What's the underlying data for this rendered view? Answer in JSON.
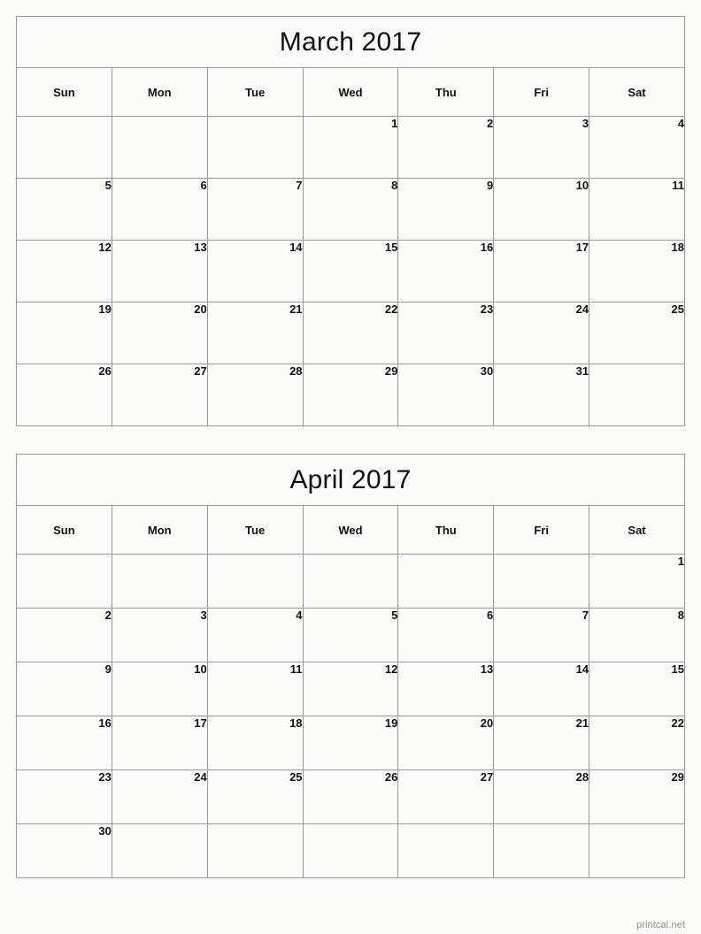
{
  "page": {
    "watermark": "printcal.net",
    "background_color": "#fbfdf8",
    "border_color": "#9a9a9a",
    "text_color": "#101010",
    "watermark_color": "#8d8d8d"
  },
  "calendars": [
    {
      "id": "march-2017",
      "title": "March 2017",
      "month": "March",
      "year": "2017",
      "weekdays": [
        "Sun",
        "Mon",
        "Tue",
        "Wed",
        "Thu",
        "Fri",
        "Sat"
      ],
      "weeks": [
        [
          "",
          "",
          "",
          "1",
          "2",
          "3",
          "4"
        ],
        [
          "5",
          "6",
          "7",
          "8",
          "9",
          "10",
          "11"
        ],
        [
          "12",
          "13",
          "14",
          "15",
          "16",
          "17",
          "18"
        ],
        [
          "19",
          "20",
          "21",
          "22",
          "23",
          "24",
          "25"
        ],
        [
          "26",
          "27",
          "28",
          "29",
          "30",
          "31",
          ""
        ]
      ]
    },
    {
      "id": "april-2017",
      "title": "April 2017",
      "month": "April",
      "year": "2017",
      "weekdays": [
        "Sun",
        "Mon",
        "Tue",
        "Wed",
        "Thu",
        "Fri",
        "Sat"
      ],
      "weeks": [
        [
          "",
          "",
          "",
          "",
          "",
          "",
          "1"
        ],
        [
          "2",
          "3",
          "4",
          "5",
          "6",
          "7",
          "8"
        ],
        [
          "9",
          "10",
          "11",
          "12",
          "13",
          "14",
          "15"
        ],
        [
          "16",
          "17",
          "18",
          "19",
          "20",
          "21",
          "22"
        ],
        [
          "23",
          "24",
          "25",
          "26",
          "27",
          "28",
          "29"
        ],
        [
          "30",
          "",
          "",
          "",
          "",
          "",
          ""
        ]
      ]
    }
  ]
}
